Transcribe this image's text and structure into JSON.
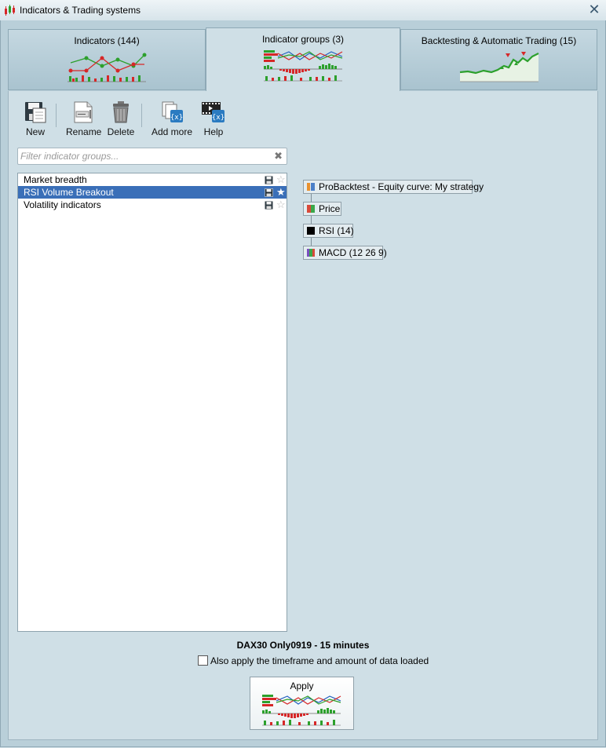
{
  "window": {
    "title": "Indicators & Trading systems"
  },
  "tabs": [
    {
      "label": "Indicators (144)"
    },
    {
      "label": "Indicator groups (3)"
    },
    {
      "label": "Backtesting & Automatic Trading (15)"
    }
  ],
  "toolbar": {
    "new_label": "New",
    "rename_label": "Rename",
    "delete_label": "Delete",
    "add_more_label": "Add more",
    "help_label": "Help"
  },
  "filter": {
    "placeholder": "Filter indicator groups...",
    "value": ""
  },
  "groups": [
    {
      "label": "Market breadth",
      "favorite": false,
      "selected": false
    },
    {
      "label": "RSI Volume Breakout",
      "favorite": true,
      "selected": true
    },
    {
      "label": "Volatility indicators",
      "favorite": false,
      "selected": false
    }
  ],
  "indicators": [
    {
      "label": "ProBacktest - Equity curve: My strategy",
      "color": "#e8912f"
    },
    {
      "label": "Price",
      "color": "#d84a3a"
    },
    {
      "label": "RSI (14)",
      "color": "#000000"
    },
    {
      "label": "MACD (12 26 9)",
      "color": "#7a4fc0"
    }
  ],
  "footer": {
    "ticker": "DAX30 Only0919 - 15 minutes",
    "also_apply_label": "Also apply the timeframe and amount of data loaded",
    "also_apply_checked": false,
    "apply_label": "Apply"
  },
  "colors": {
    "selection": "#3a6fb8",
    "background": "#cfdfe6",
    "chart_green": "#2ca02c",
    "chart_red": "#d62728",
    "chart_blue": "#1f5fbf"
  },
  "icons": [
    "app-chart-icon",
    "close-icon",
    "new-document-icon",
    "rename-icon",
    "trash-icon",
    "add-more-icon",
    "help-video-icon",
    "save-icon",
    "star-icon",
    "clear-icon"
  ]
}
